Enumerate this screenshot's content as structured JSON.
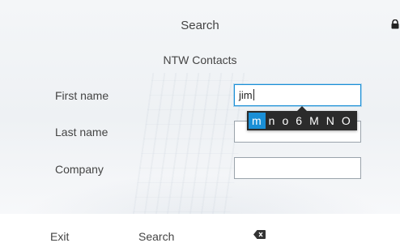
{
  "header": {
    "title": "Search",
    "subtitle": "NTW Contacts",
    "lock_icon": "lock-icon"
  },
  "form": {
    "first_name": {
      "label": "First name",
      "value": "jim"
    },
    "last_name": {
      "label": "Last name",
      "value": ""
    },
    "company": {
      "label": "Company",
      "value": ""
    }
  },
  "suggestions": {
    "options": [
      "m",
      "n",
      "o",
      "6",
      "M",
      "N",
      "O"
    ],
    "selected_index": 0
  },
  "softkeys": {
    "exit_label": "Exit",
    "search_label": "Search",
    "backspace_icon": "backspace-icon"
  },
  "colors": {
    "accent": "#1a8fd6",
    "popup_bg": "#2b2b2b"
  }
}
